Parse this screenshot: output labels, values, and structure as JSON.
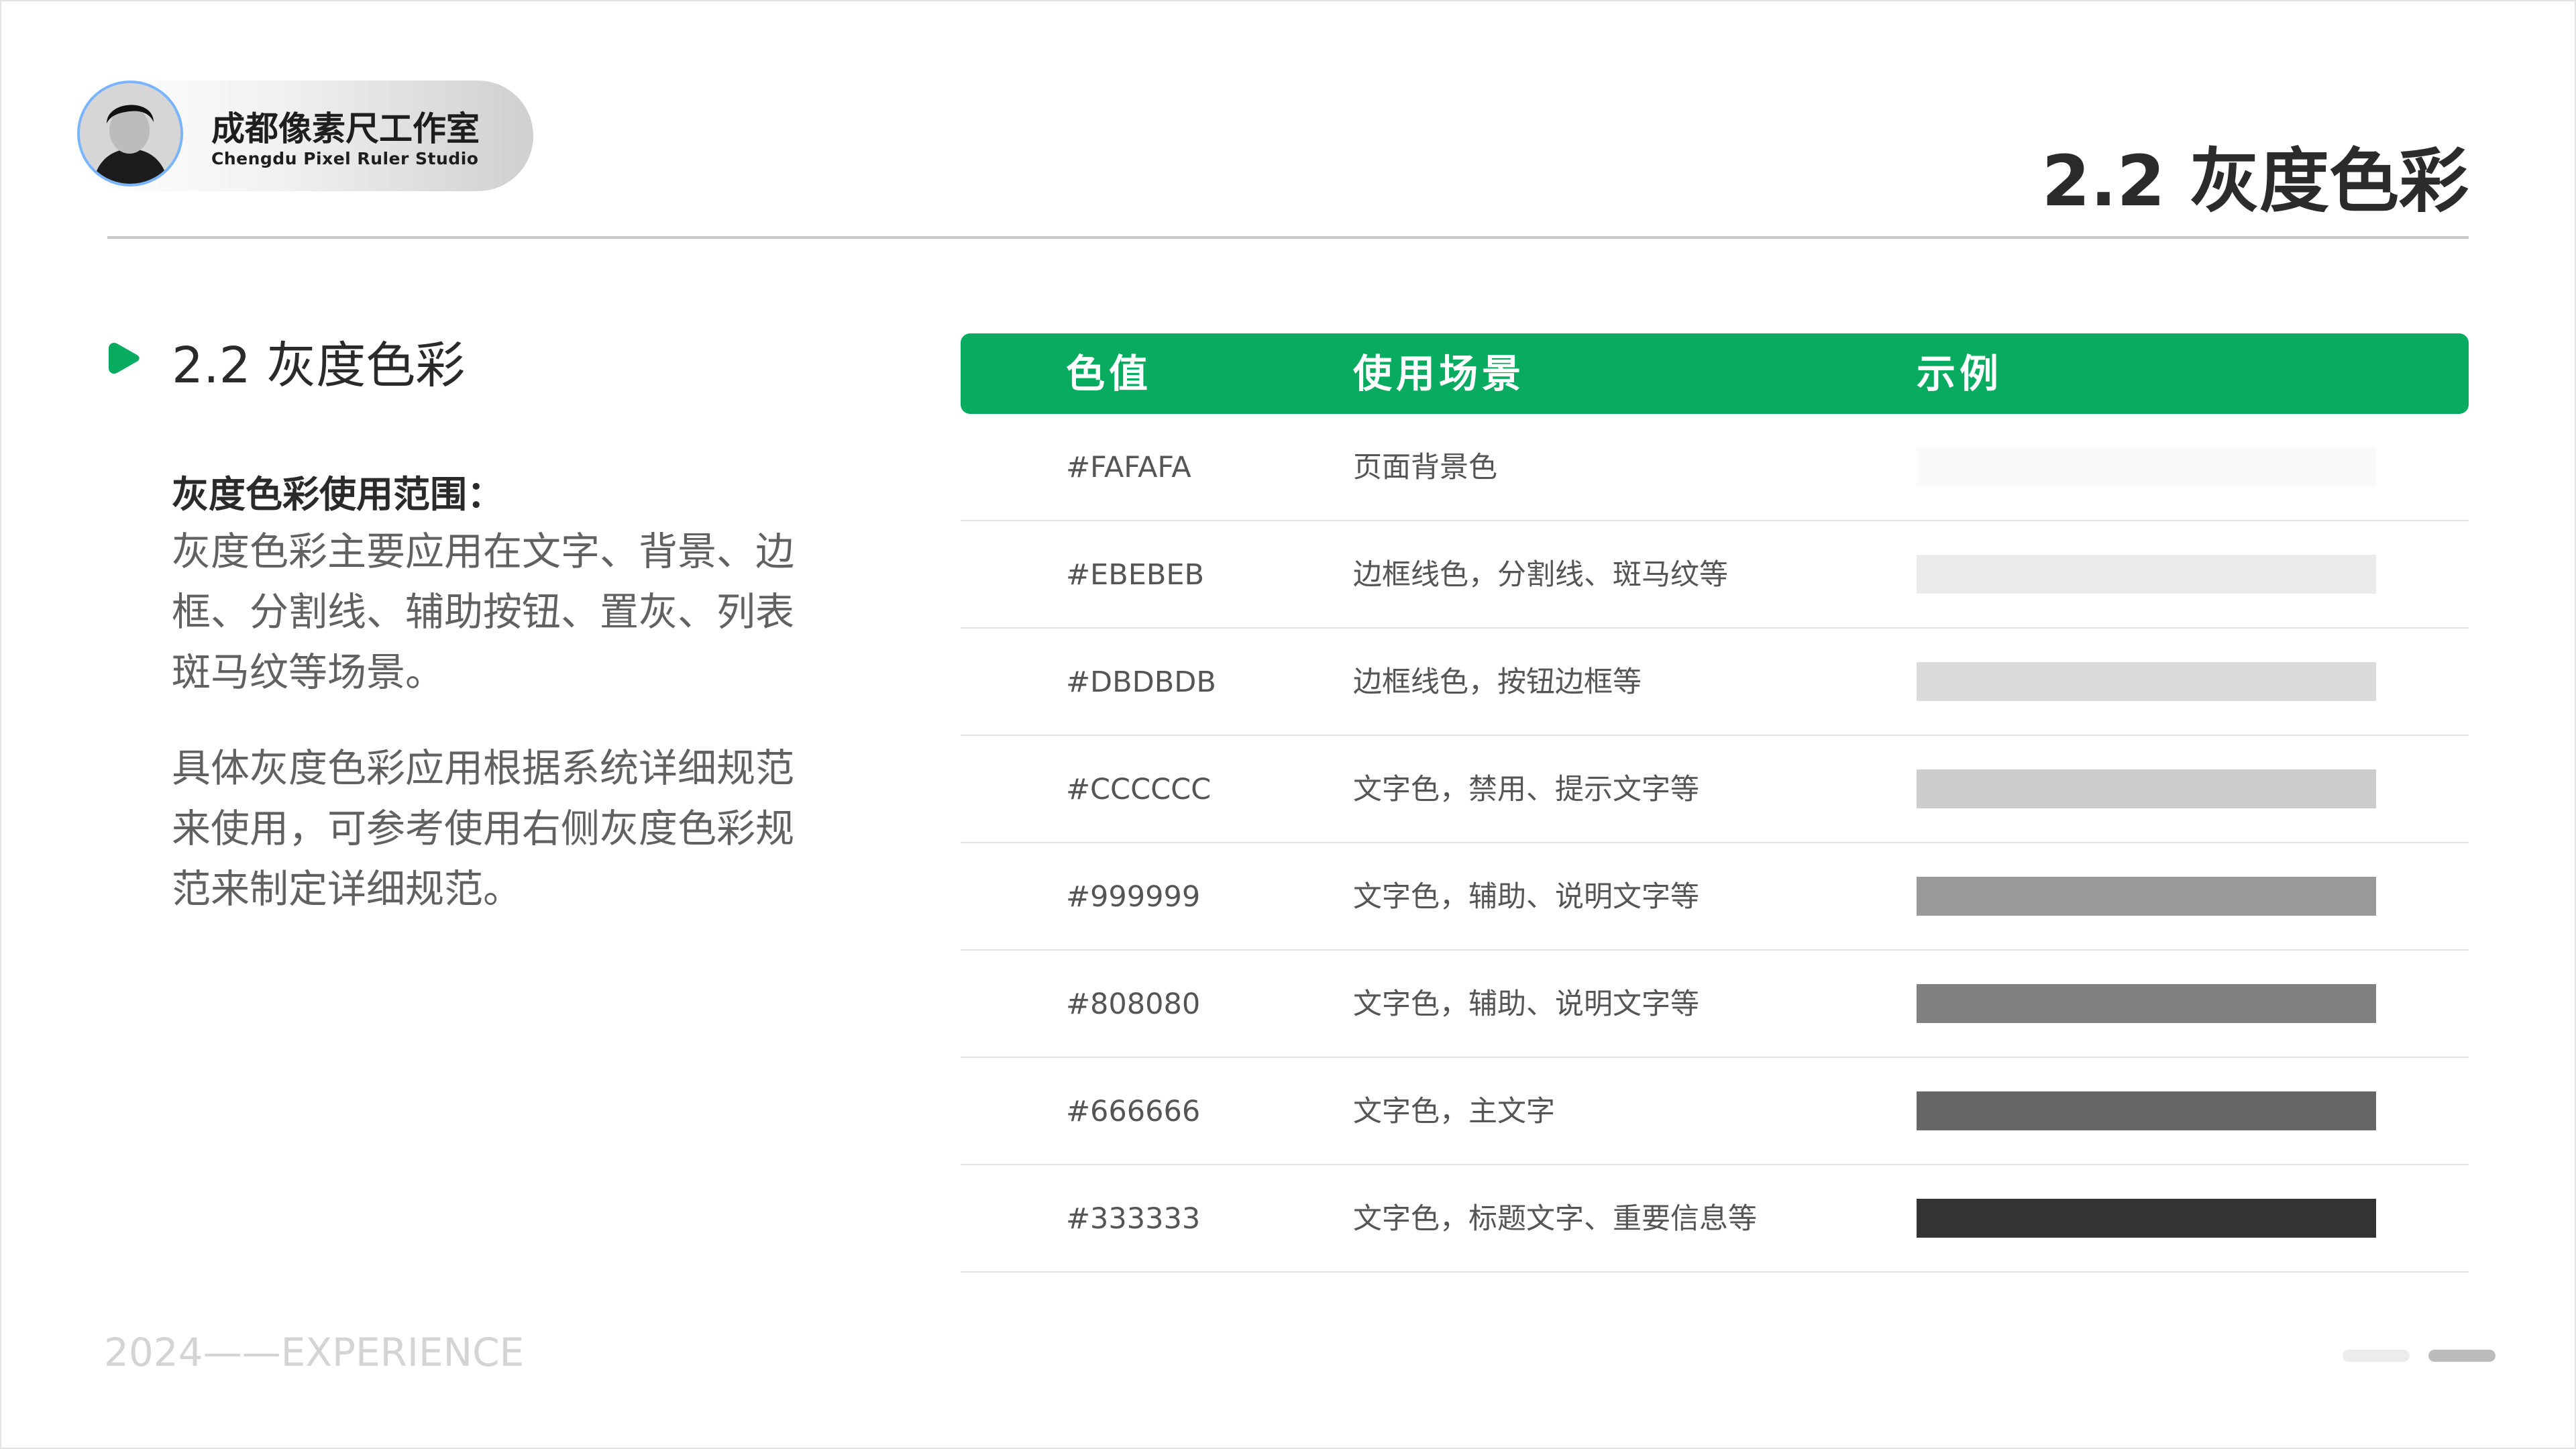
{
  "brand": {
    "name": "成都像素尺工作室",
    "subtitle": "Chengdu Pixel Ruler Studio"
  },
  "page_title": "2.2 灰度色彩",
  "section": {
    "title": "2.2 灰度色彩",
    "heading": "灰度色彩使用范围：",
    "paragraph1": "灰度色彩主要应用在文字、背景、边框、分割线、辅助按钮、置灰、列表斑马纹等场景。",
    "paragraph2": "具体灰度色彩应用根据系统详细规范来使用，可参考使用右侧灰度色彩规范来制定详细规范。"
  },
  "table": {
    "headers": {
      "value": "色值",
      "usage": "使用场景",
      "example": "示例"
    },
    "rows": [
      {
        "value": "#FAFAFA",
        "usage": "页面背景色",
        "swatch": "#FAFAFA"
      },
      {
        "value": "#EBEBEB",
        "usage": "边框线色，分割线、斑马纹等",
        "swatch": "#EBEBEB"
      },
      {
        "value": "#DBDBDB",
        "usage": "边框线色，按钮边框等",
        "swatch": "#DBDBDB"
      },
      {
        "value": "#CCCCCC",
        "usage": "文字色，禁用、提示文字等",
        "swatch": "#CCCCCC"
      },
      {
        "value": "#999999",
        "usage": "文字色，辅助、说明文字等",
        "swatch": "#999999"
      },
      {
        "value": "#808080",
        "usage": "文字色，辅助、说明文字等",
        "swatch": "#808080"
      },
      {
        "value": "#666666",
        "usage": "文字色，主文字",
        "swatch": "#666666"
      },
      {
        "value": "#333333",
        "usage": "文字色，标题文字、重要信息等",
        "swatch": "#333333"
      }
    ]
  },
  "footer": {
    "text": "2024——EXPERIENCE"
  },
  "colors": {
    "accent": "#08AB5F",
    "title_text": "#2B2B2B",
    "body_text": "#616161",
    "divider": "#E4E4E4"
  },
  "icons": {
    "section_marker": "play-icon",
    "avatar": "avatar"
  }
}
